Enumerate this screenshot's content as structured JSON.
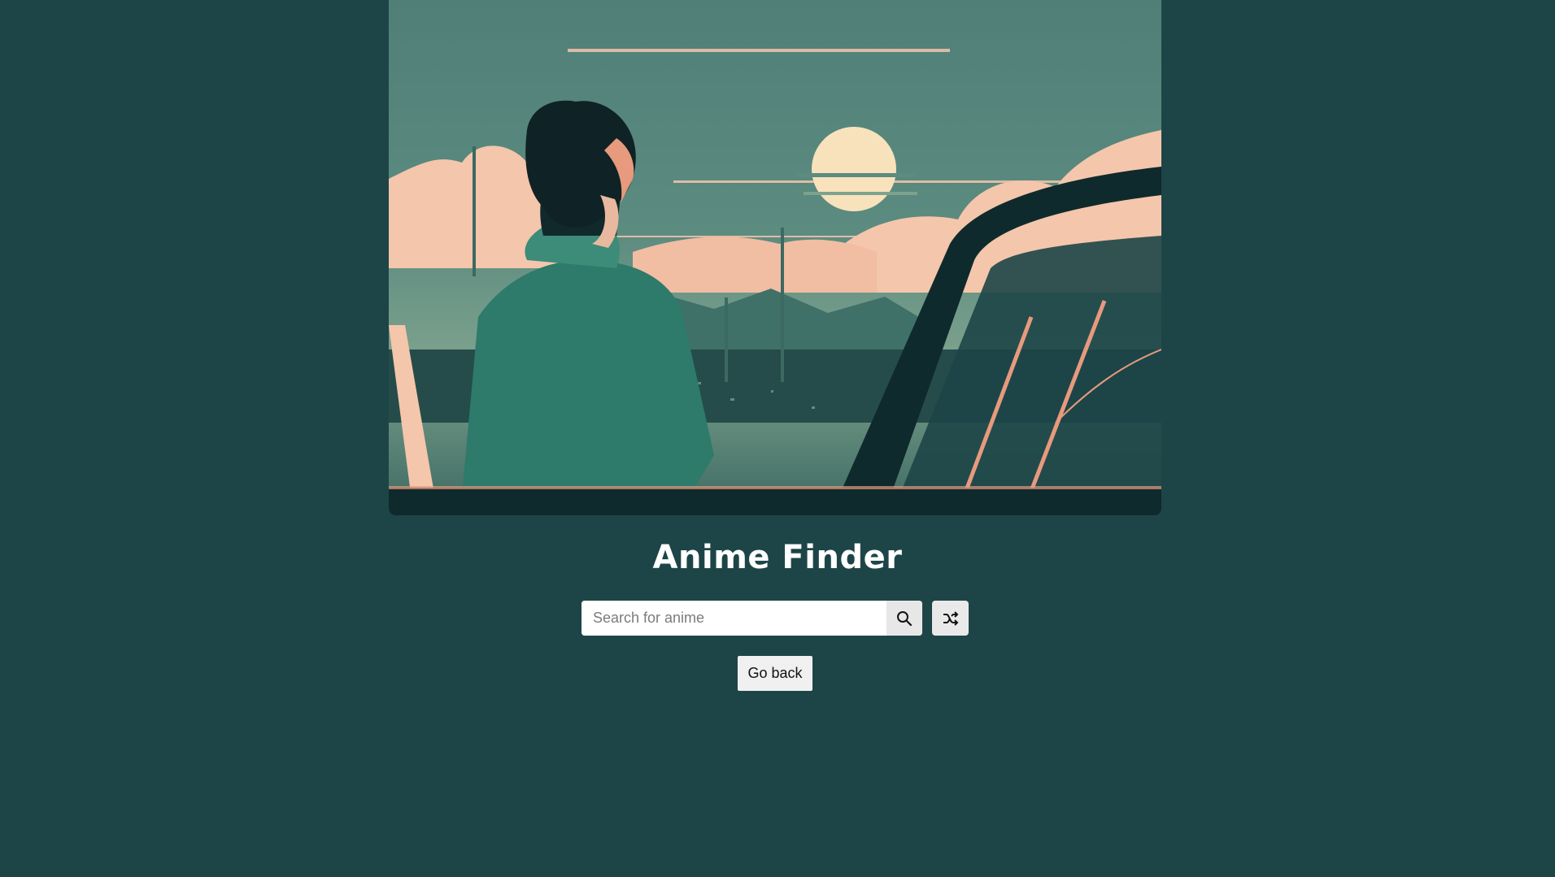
{
  "hero": {
    "colors": {
      "sky": "#4d7c75",
      "cloud": "#f4c6ab",
      "sun": "#f8e2bc",
      "dark": "#0f2a2c",
      "hoodie": "#2e7a6b",
      "accent": "#e79a7d"
    }
  },
  "title": "Anime Finder",
  "search": {
    "placeholder": "Search for anime",
    "value": ""
  },
  "icons": {
    "search": "search-icon",
    "random": "shuffle-icon"
  },
  "back_button_label": "Go back",
  "colors": {
    "background": "#1d4547",
    "title": "#ffffff",
    "button_bg": "#f0f0f0"
  }
}
